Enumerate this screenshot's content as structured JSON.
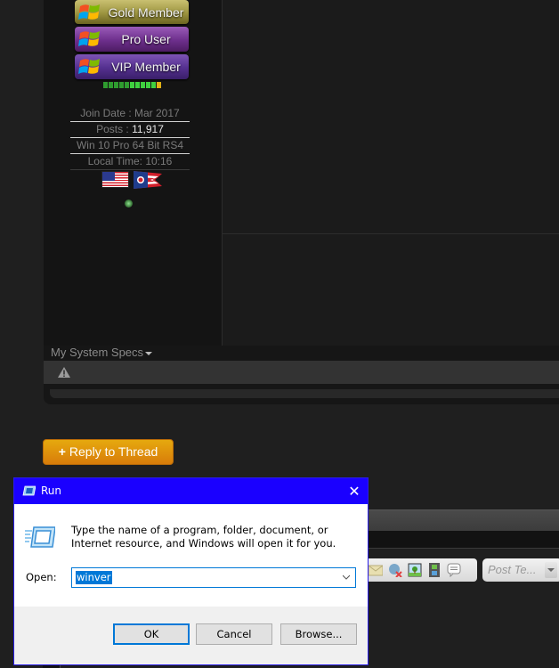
{
  "post": {
    "user_ranks": [
      {
        "label": "Gold Member",
        "style": "gold"
      },
      {
        "label": "Pro User",
        "style": "pro"
      },
      {
        "label": "VIP Member",
        "style": "vip"
      }
    ],
    "reputation": {
      "filled_segments": 10,
      "total_segments": 11
    },
    "stats": {
      "join_date": "Join Date : Mar 2017",
      "posts_label": "Posts : ",
      "posts_value": "11,917",
      "os": "Win 10 Pro 64 Bit RS4",
      "local_time": "Local Time: 10:16"
    },
    "flags": [
      "us-flag",
      "ohio-flag"
    ],
    "online_status": "online",
    "system_specs_label": "My System Specs"
  },
  "reply_button": {
    "plus": "+",
    "label": "Reply to Thread"
  },
  "quick_reply": {
    "toolbar_icons": [
      "email-icon",
      "unlink-icon",
      "image-icon",
      "video-icon",
      "quote-icon"
    ],
    "post_template_placeholder": "Post Te..."
  },
  "run_dialog": {
    "title": "Run",
    "close_glyph": "✕",
    "description": "Type the name of a program, folder, document, or Internet resource, and Windows will open it for you.",
    "open_label": "Open:",
    "open_value": "winver",
    "buttons": {
      "ok": "OK",
      "cancel": "Cancel",
      "browse": "Browse..."
    }
  },
  "colors": {
    "titlebar": "#1a00ff",
    "accent": "#0078d7",
    "reply_button": "#e09a0c"
  }
}
